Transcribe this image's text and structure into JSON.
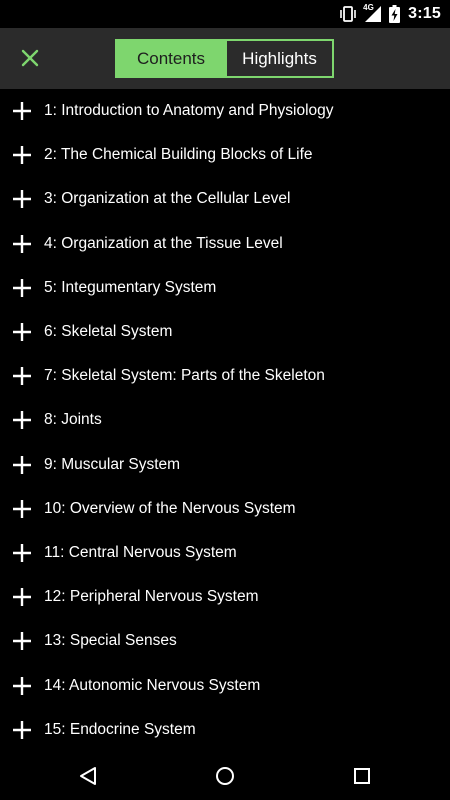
{
  "status_bar": {
    "time": "3:15",
    "network": "4G",
    "icons": [
      "vibrate-icon",
      "signal-icon",
      "battery-charging-icon"
    ]
  },
  "toolbar": {
    "close_icon": "close-icon",
    "tabs": [
      {
        "label": "Contents",
        "active": true
      },
      {
        "label": "Highlights",
        "active": false
      }
    ]
  },
  "chapters": [
    {
      "label": "1: Introduction to Anatomy and Physiology",
      "icon": "plus-icon"
    },
    {
      "label": "2: The Chemical Building Blocks of Life",
      "icon": "plus-icon"
    },
    {
      "label": "3: Organization at the Cellular Level",
      "icon": "plus-icon"
    },
    {
      "label": "4: Organization at the Tissue Level",
      "icon": "plus-icon"
    },
    {
      "label": "5: Integumentary System",
      "icon": "plus-icon"
    },
    {
      "label": "6: Skeletal System",
      "icon": "plus-icon"
    },
    {
      "label": "7: Skeletal System: Parts of the Skeleton",
      "icon": "plus-icon"
    },
    {
      "label": "8: Joints",
      "icon": "plus-icon"
    },
    {
      "label": "9: Muscular System",
      "icon": "plus-icon"
    },
    {
      "label": "10: Overview of the Nervous System",
      "icon": "plus-icon"
    },
    {
      "label": "11: Central Nervous System",
      "icon": "plus-icon"
    },
    {
      "label": "12: Peripheral Nervous System",
      "icon": "plus-icon"
    },
    {
      "label": "13: Special Senses",
      "icon": "plus-icon"
    },
    {
      "label": "14: Autonomic Nervous System",
      "icon": "plus-icon"
    },
    {
      "label": "15: Endocrine System",
      "icon": "plus-icon"
    }
  ],
  "nav_bar": {
    "icons": [
      "back-icon",
      "home-icon",
      "recents-icon"
    ]
  },
  "colors": {
    "accent": "#7ed66e",
    "toolbar_bg": "#2b2b2b",
    "background": "#000000",
    "text": "#ffffff"
  }
}
